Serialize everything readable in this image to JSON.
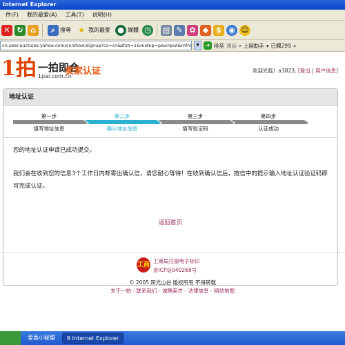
{
  "window": {
    "title": "Internet Explorer"
  },
  "menu": [
    "件(F)",
    "我的最爱(A)",
    "工具(T)",
    "说明(H)"
  ],
  "toolbar": {
    "search": "搜尋",
    "favorites": "我的最爱",
    "media": "媒體"
  },
  "address": {
    "url": "cn.user.auctions.yahoo.com/cn/show/signup?cc=cn&sfsh=1&mstep=pavinput&mfromref=",
    "go": "移至",
    "connect": "通話",
    "helper": "上网助手",
    "blocked": "已欄299"
  },
  "header": {
    "logo_mark": "1拍",
    "logo_cn": "一拍即合",
    "logo_sub": "1pai.com.cn",
    "section_title": "卖家认证",
    "welcome": "欢迎光临！a3823,",
    "logout": "[登出",
    "user_info": "用户信息]"
  },
  "panel": {
    "title": "地址认证",
    "steps": [
      {
        "num": "第一步",
        "desc": "填写地址信息",
        "color": "#8a8a8a",
        "active": false
      },
      {
        "num": "第二步",
        "desc": "确认地址信息",
        "color": "#2bb0d0",
        "active": true
      },
      {
        "num": "第三步",
        "desc": "填写验证码",
        "color": "#8a8a8a",
        "active": false
      },
      {
        "num": "第四步",
        "desc": "认证成功",
        "color": "#8a8a8a",
        "active": false
      }
    ],
    "message1": "您的地址认证申请已成功提交。",
    "message2": "我们会在收到您的信息3个工作日内邮寄出确认信，请您耐心等待！在收到确认信后，按信中的提示输入地址认证验证码即可完成认证。",
    "back": "返回首页"
  },
  "footer": {
    "badge": "工商",
    "line1": "工商局注册电子标识",
    "line2": "京ICP证040268号",
    "copyright": "© 2005  阳光山谷  版权所有  不得转载",
    "links": "关于一拍 - 联系我们 - 诚聘英才 - 法律信息 - 网站地图"
  },
  "taskbar": {
    "item1": "爱喜小秘盟",
    "item2": "8 Internet Explorer"
  },
  "colors": {
    "accent": "#e8590c",
    "link": "#9c2a5a",
    "active_step": "#2bb0d0"
  }
}
